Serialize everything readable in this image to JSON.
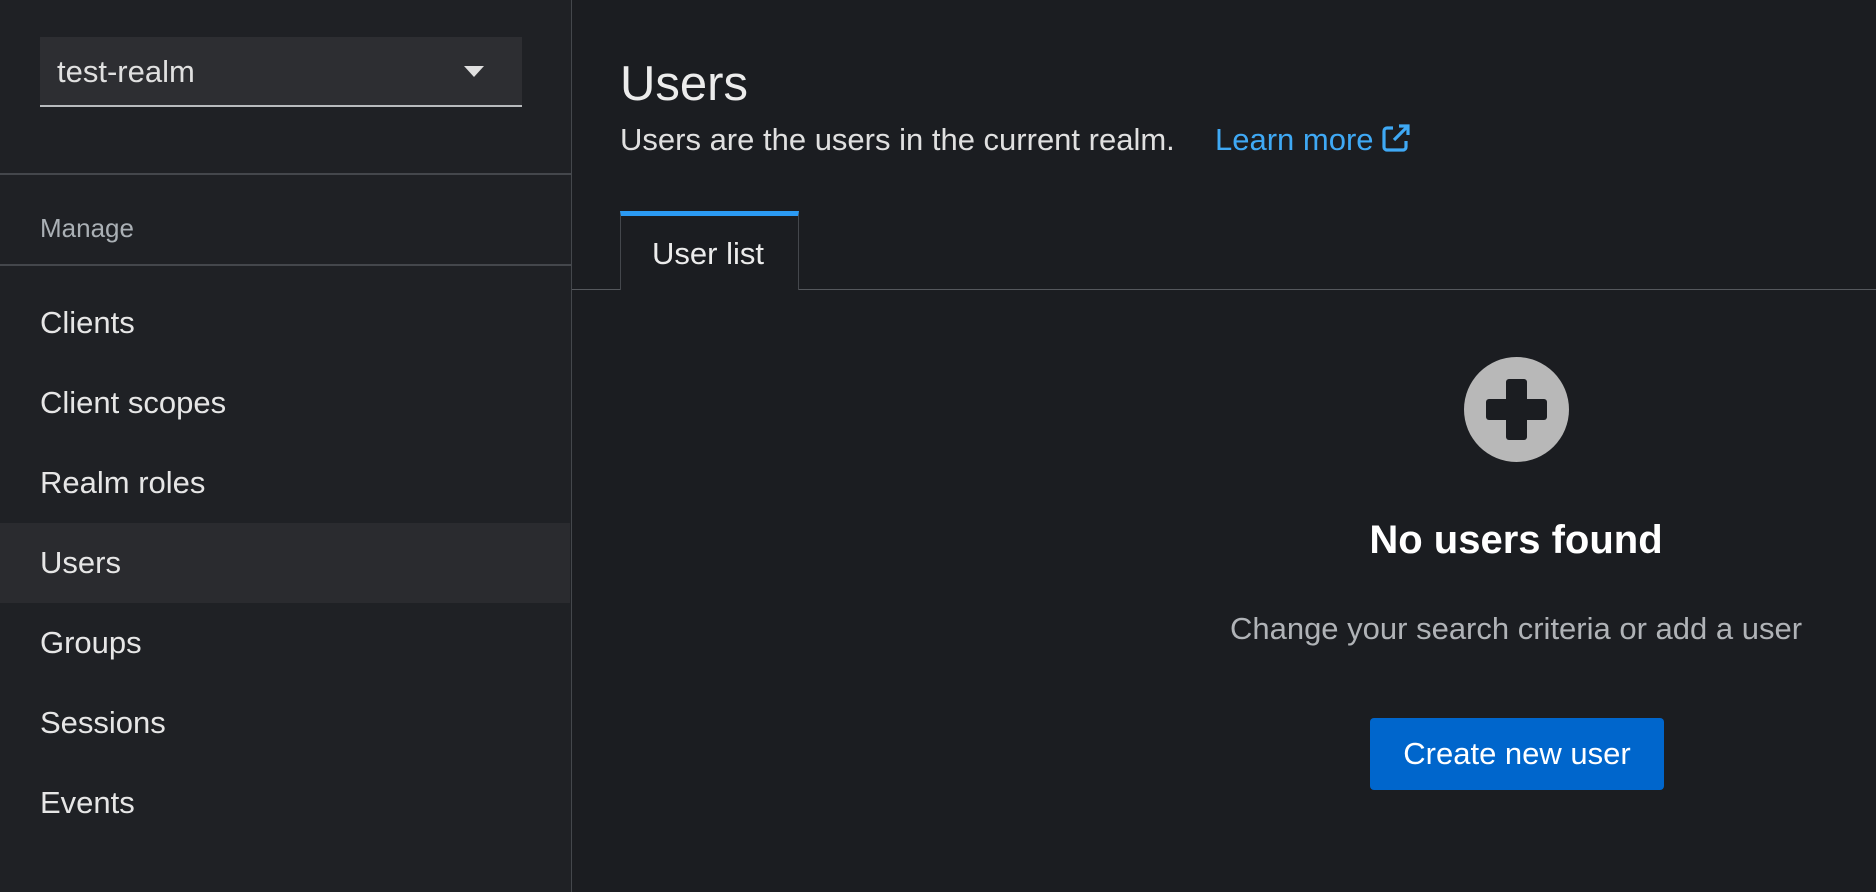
{
  "realm_selector": {
    "value": "test-realm"
  },
  "sidebar": {
    "section_label": "Manage",
    "items": [
      {
        "label": "Clients"
      },
      {
        "label": "Client scopes"
      },
      {
        "label": "Realm roles"
      },
      {
        "label": "Users",
        "active": true
      },
      {
        "label": "Groups"
      },
      {
        "label": "Sessions"
      },
      {
        "label": "Events"
      }
    ]
  },
  "header": {
    "title": "Users",
    "description": "Users are the users in the current realm.",
    "learn_more": "Learn more"
  },
  "tabs": [
    {
      "label": "User list",
      "active": true
    }
  ],
  "empty_state": {
    "icon": "plus-circle-icon",
    "title": "No users found",
    "body": "Change your search criteria or add a user",
    "button_label": "Create new user"
  },
  "colors": {
    "accent": "#2b9af3",
    "link": "#3fa9f5",
    "primary_button": "#0066cc",
    "background": "#1b1d21"
  }
}
